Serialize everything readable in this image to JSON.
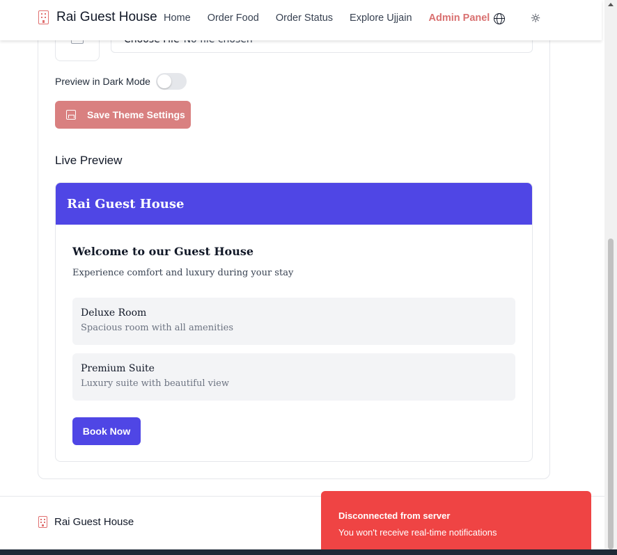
{
  "header": {
    "brand": "Rai Guest House",
    "nav": [
      "Home",
      "Order Food",
      "Order Status",
      "Explore Ujjain"
    ],
    "admin_panel": "Admin Panel",
    "language_icon": "globe-icon",
    "theme_icon": "sun-icon",
    "brand_color": "#e07070"
  },
  "settings": {
    "file_button": "Choose File",
    "file_status": "No file chosen",
    "dark_mode_label": "Preview in Dark Mode",
    "dark_mode_on": false,
    "save_label": "Save Theme Settings",
    "save_color": "#d98080"
  },
  "preview": {
    "section_title": "Live Preview",
    "header_title": "Rai Guest House",
    "header_color": "#4f46e5",
    "welcome": "Welcome to our Guest House",
    "subtitle": "Experience comfort and luxury during your stay",
    "rooms": [
      {
        "name": "Deluxe Room",
        "desc": "Spacious room with all amenities"
      },
      {
        "name": "Premium Suite",
        "desc": "Luxury suite with beautiful view"
      }
    ],
    "book_label": "Book Now"
  },
  "footer": {
    "brand": "Rai Guest House"
  },
  "toast": {
    "title": "Disconnected from server",
    "message": "You won't receive real-time notifications",
    "color": "#ef4444"
  }
}
